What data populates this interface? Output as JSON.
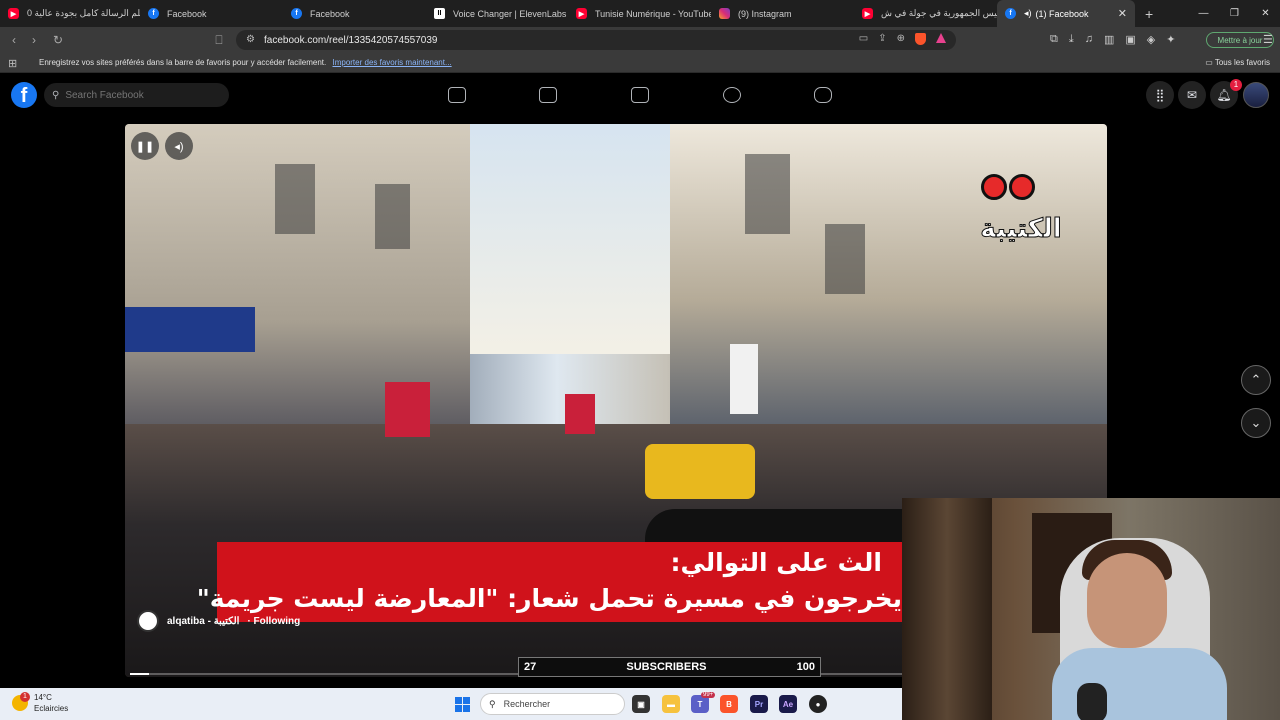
{
  "tabs": [
    {
      "label": "فيلم الرسالة كامل بجودة عالية 0",
      "icon": "youtube-icon",
      "active": false
    },
    {
      "label": "Facebook",
      "icon": "facebook-icon",
      "active": false
    },
    {
      "label": "Facebook",
      "icon": "facebook-icon",
      "active": false
    },
    {
      "label": "Voice Changer | ElevenLabs",
      "icon": "elevenlabs-icon",
      "active": false
    },
    {
      "label": "Tunisie Numérique - YouTube",
      "icon": "youtube-icon",
      "active": false
    },
    {
      "label": "(9) Instagram",
      "icon": "instagram-icon",
      "active": false
    },
    {
      "label": "رئيس الجمهورية في جولة في ش...",
      "icon": "youtube-icon",
      "active": false
    },
    {
      "label": "(1) Facebook",
      "icon": "facebook-icon",
      "active": true
    }
  ],
  "tab_close": "✕",
  "new_tab": "+",
  "window_controls": {
    "minimize": "—",
    "restore": "❐",
    "close": "✕"
  },
  "address": {
    "url": "facebook.com/reel/1335420574557039"
  },
  "update_button": "Mettre à jour",
  "bookmarks": {
    "message": "Enregistrez vos sites préférés dans la barre de favoris pour y accéder facilement.",
    "import_link": "Importer des favoris maintenant...",
    "all_favorites": "Tous les favoris"
  },
  "facebook": {
    "logo": "f",
    "search_placeholder": "Search Facebook",
    "notification_count": "1"
  },
  "video": {
    "channel": "alqatiba - الكتيبة",
    "follow_status": "· Following",
    "banner_line1": "الث على التوالي:",
    "banner_line2": "يخرجون في مسيرة تحمل شعار: \"المعارضة ليست جريمة\"",
    "watermark": "الكتيبة",
    "progress": 0.02
  },
  "subscribers": {
    "left": "27",
    "label": "SUBSCRIBERS",
    "right": "100"
  },
  "taskbar": {
    "temperature": "14°C",
    "weather": "Eclaircies",
    "weather_badge": "1",
    "search_placeholder": "Rechercher",
    "teams_badge": "99+"
  },
  "colors": {
    "facebook_blue": "#1877f2",
    "youtube_red": "#ff0033",
    "banner_red": "#d0121b",
    "update_green": "#8ad39b"
  }
}
